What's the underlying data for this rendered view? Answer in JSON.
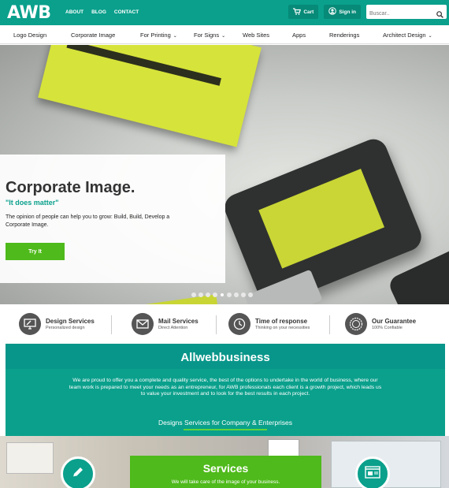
{
  "header": {
    "logo": "AWB",
    "links": [
      "ABOUT",
      "BLOG",
      "CONTACT"
    ],
    "cart_label": "Cart",
    "signin_label": "Sign in",
    "search_placeholder": "Buscar..",
    "color": "#0aa08c"
  },
  "nav": {
    "items": [
      "Logo Design",
      "Corporate Image",
      "For Printing",
      "For Signs",
      "Web Sites",
      "Apps",
      "Renderings",
      "Architect Design"
    ]
  },
  "hero": {
    "title": "Corporate Image.",
    "subtitle": "\"It does matter\"",
    "text": "The opinion of people can help you to grow: Build, Build, Develop a Corporate Image.",
    "button_label": "Try It",
    "slide_count": 9,
    "active_slide": 4
  },
  "features": [
    {
      "title": "Design Services",
      "sub": "Personalized design",
      "icon": "monitor-icon"
    },
    {
      "title": "Mail Services",
      "sub": "Direct Attention",
      "icon": "envelope-icon"
    },
    {
      "title": "Time of response",
      "sub": "Thinking on your necessities",
      "icon": "clock-icon"
    },
    {
      "title": "Our Guarantee",
      "sub": "100% Confiable",
      "icon": "seal-icon"
    }
  ],
  "intro": {
    "title": "Allwebbusiness",
    "text": "We are proud to offer you a complete and quality service, the best of the options to undertake in the world of business, where our team work is prepared to meet your needs as an entrepreneur, for AWB professionals each client is a growth project, which leads us to value your investment and to look for the best results in each project.",
    "link": "Designs Services for Company & Enterprises"
  },
  "services": {
    "title": "Services",
    "subtitle": "We will take care of the image of your business."
  },
  "colors": {
    "accent": "#0aa08c",
    "green": "#4fba1b"
  }
}
